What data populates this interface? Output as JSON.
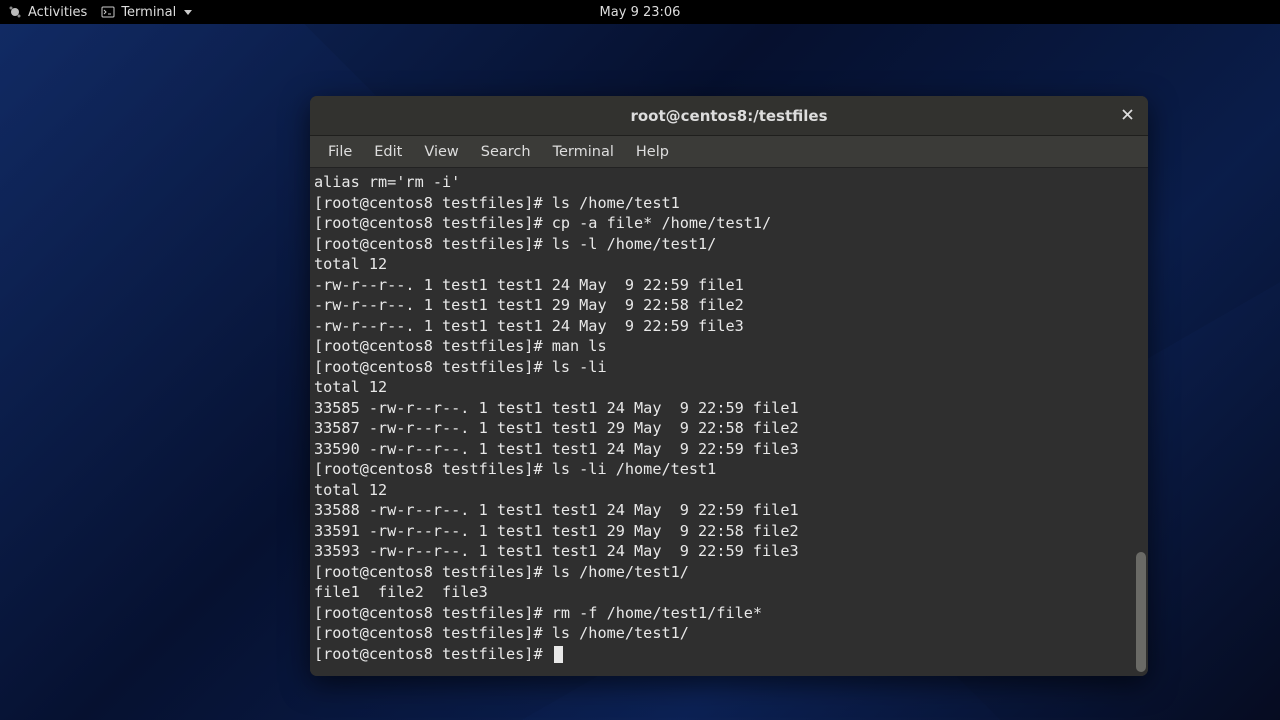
{
  "panel": {
    "activities": "Activities",
    "app_name": "Terminal",
    "clock": "May 9  23:06"
  },
  "window": {
    "title": "root@centos8:/testfiles",
    "menus": [
      "File",
      "Edit",
      "View",
      "Search",
      "Terminal",
      "Help"
    ]
  },
  "terminal_lines": [
    "alias rm='rm -i'",
    "[root@centos8 testfiles]# ls /home/test1",
    "[root@centos8 testfiles]# cp -a file* /home/test1/",
    "[root@centos8 testfiles]# ls -l /home/test1/",
    "total 12",
    "-rw-r--r--. 1 test1 test1 24 May  9 22:59 file1",
    "-rw-r--r--. 1 test1 test1 29 May  9 22:58 file2",
    "-rw-r--r--. 1 test1 test1 24 May  9 22:59 file3",
    "[root@centos8 testfiles]# man ls",
    "[root@centos8 testfiles]# ls -li",
    "total 12",
    "33585 -rw-r--r--. 1 test1 test1 24 May  9 22:59 file1",
    "33587 -rw-r--r--. 1 test1 test1 29 May  9 22:58 file2",
    "33590 -rw-r--r--. 1 test1 test1 24 May  9 22:59 file3",
    "[root@centos8 testfiles]# ls -li /home/test1",
    "total 12",
    "33588 -rw-r--r--. 1 test1 test1 24 May  9 22:59 file1",
    "33591 -rw-r--r--. 1 test1 test1 29 May  9 22:58 file2",
    "33593 -rw-r--r--. 1 test1 test1 24 May  9 22:59 file3",
    "[root@centos8 testfiles]# ls /home/test1/",
    "file1  file2  file3",
    "[root@centos8 testfiles]# rm -f /home/test1/file*",
    "[root@centos8 testfiles]# ls /home/test1/",
    "[root@centos8 testfiles]# "
  ]
}
